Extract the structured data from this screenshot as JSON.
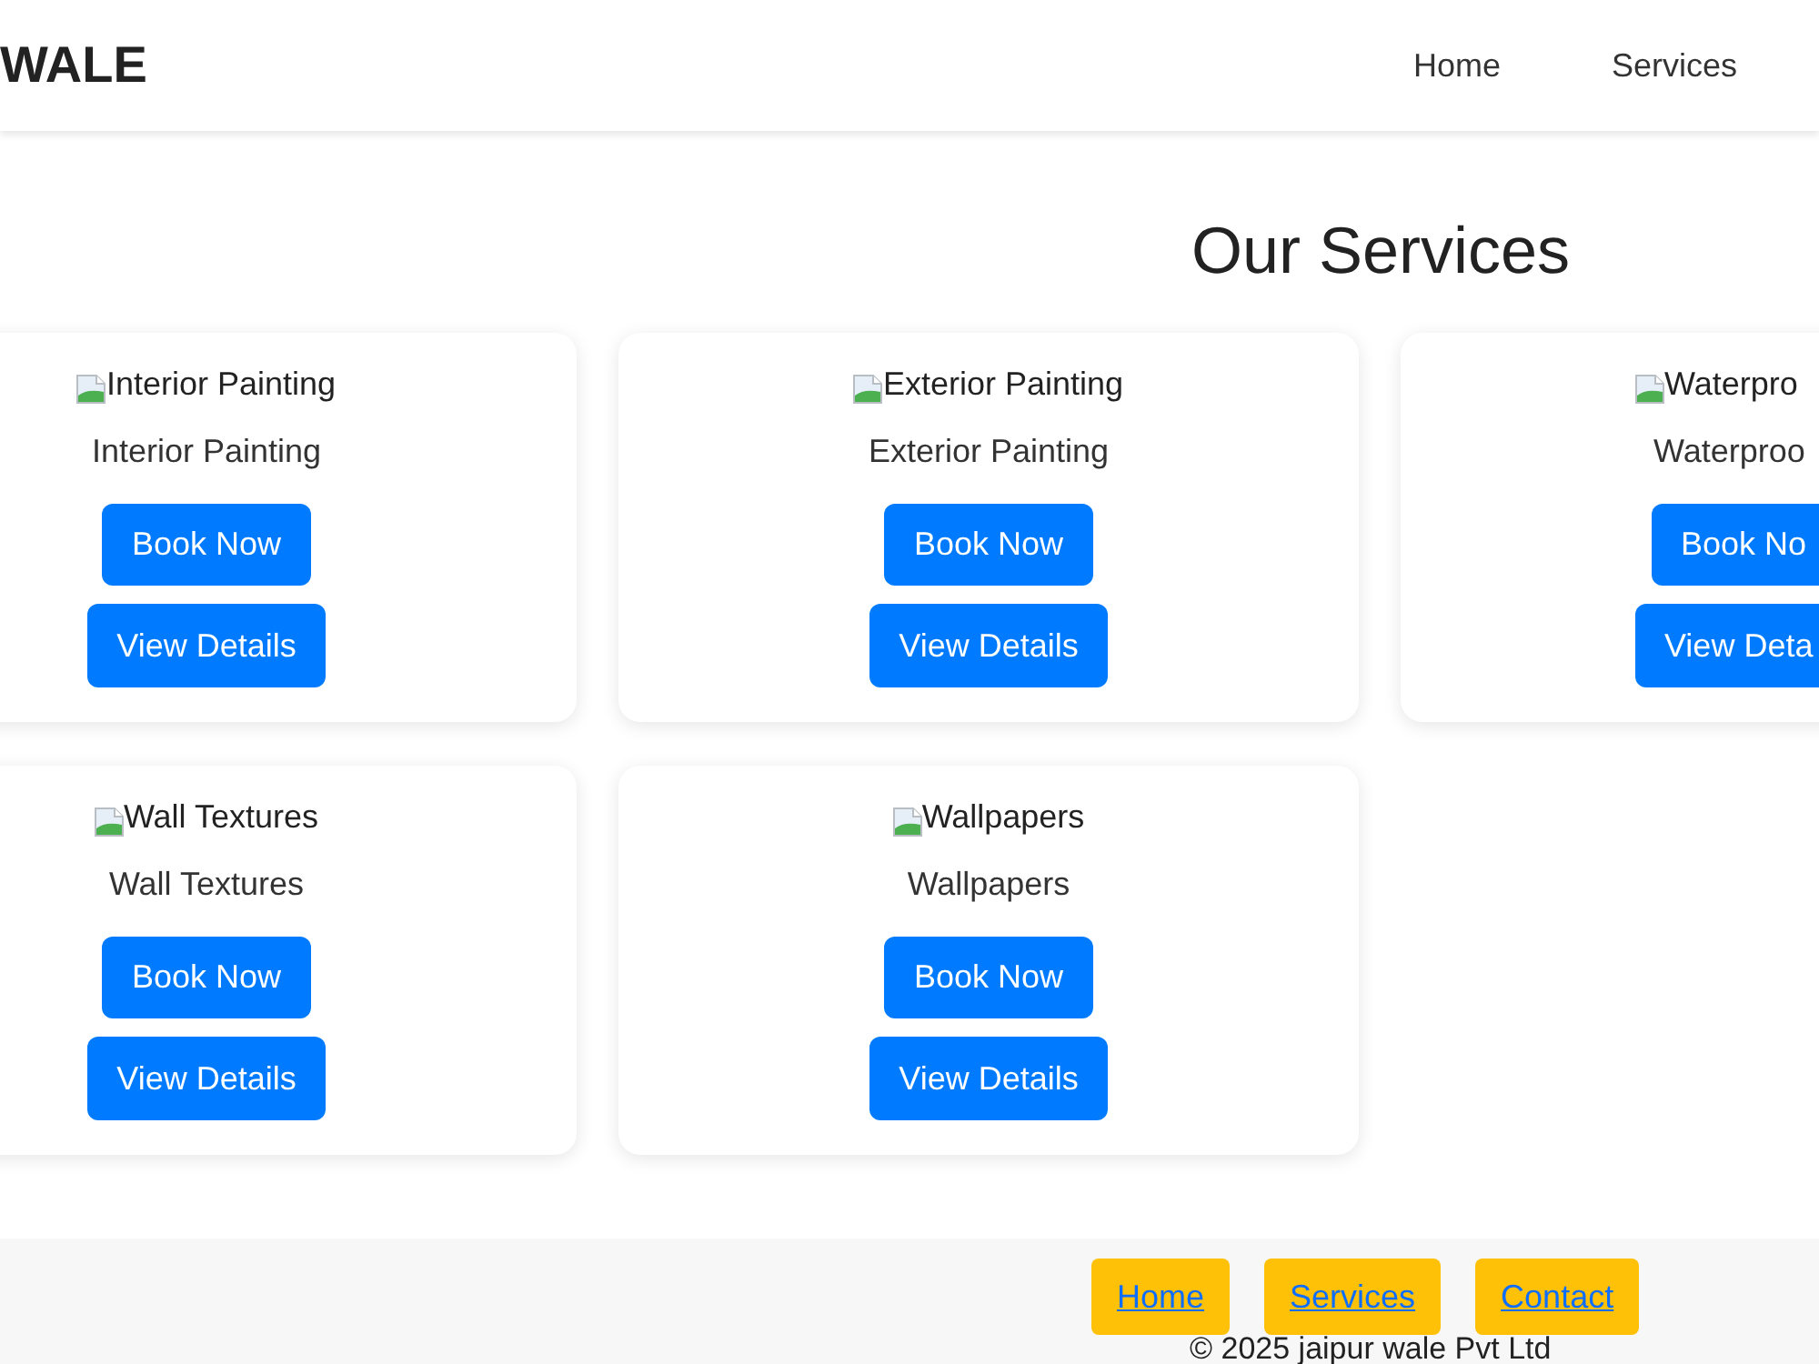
{
  "header": {
    "logo": "WALE",
    "nav": [
      "Home",
      "Services"
    ]
  },
  "page_title": "Our Services",
  "cards": [
    {
      "image_label": "Interior Painting",
      "title": "Interior Painting",
      "buttons": [
        "Book Now",
        "View Details"
      ],
      "partially_visible": false
    },
    {
      "image_label": "Exterior Painting",
      "title": "Exterior Painting",
      "buttons": [
        "Book Now",
        "View Details"
      ],
      "partially_visible": false
    },
    {
      "image_label": "Waterpro",
      "title": "Waterproo",
      "buttons": [
        "Book No",
        "View Deta"
      ],
      "partially_visible": true
    },
    {
      "image_label": "Wall Textures",
      "title": "Wall Textures",
      "buttons": [
        "Book Now",
        "View Details"
      ],
      "partially_visible": false
    },
    {
      "image_label": "Wallpapers",
      "title": "Wallpapers",
      "buttons": [
        "Book Now",
        "View Details"
      ],
      "partially_visible": false
    }
  ],
  "footer": {
    "links": [
      "Home",
      "Services",
      "Contact"
    ],
    "copyright": "© 2025 jaipur wale Pvt Ltd"
  }
}
